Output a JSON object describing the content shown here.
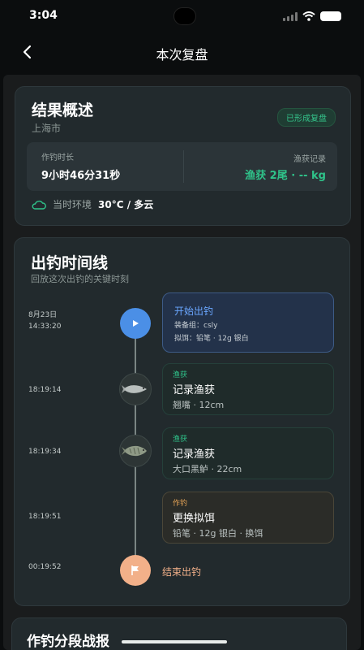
{
  "status": {
    "time": "3:04"
  },
  "nav": {
    "title": "本次复盘"
  },
  "summary": {
    "title": "结果概述",
    "city": "上海市",
    "badge": "已形成复盘",
    "duration_label": "作钓时长",
    "duration_value": "9小时46分31秒",
    "catch_label": "渔获记录",
    "catch_value": "渔获 2尾 · -- kg",
    "env_label": "当时环境",
    "env_value": "30°C / 多云"
  },
  "timeline": {
    "title": "出钓时间线",
    "subtitle": "回放这次出钓的关键时刻",
    "events": [
      {
        "date": "8月23日",
        "time": "14:33:20",
        "title": "开始出钓",
        "gear": "装备组：csly",
        "lure": "拟饵：铅笔 · 12g 银白"
      },
      {
        "time": "18:19:14",
        "tag": "渔获",
        "title": "记录渔获",
        "detail": "翘嘴 · 12cm"
      },
      {
        "time": "18:19:34",
        "tag": "渔获",
        "title": "记录渔获",
        "detail": "大口黑鲈 · 22cm"
      },
      {
        "time": "18:19:51",
        "tag": "作钓",
        "title": "更换拟饵",
        "detail": "铅笔 · 12g 银白 · 换饵"
      },
      {
        "time": "00:19:52",
        "title": "结束出钓"
      }
    ]
  },
  "segments": {
    "title": "作钓分段战报"
  },
  "colors": {
    "accent_green": "#2fc38a",
    "accent_blue": "#4b8fe6",
    "accent_orange": "#f2b089"
  }
}
